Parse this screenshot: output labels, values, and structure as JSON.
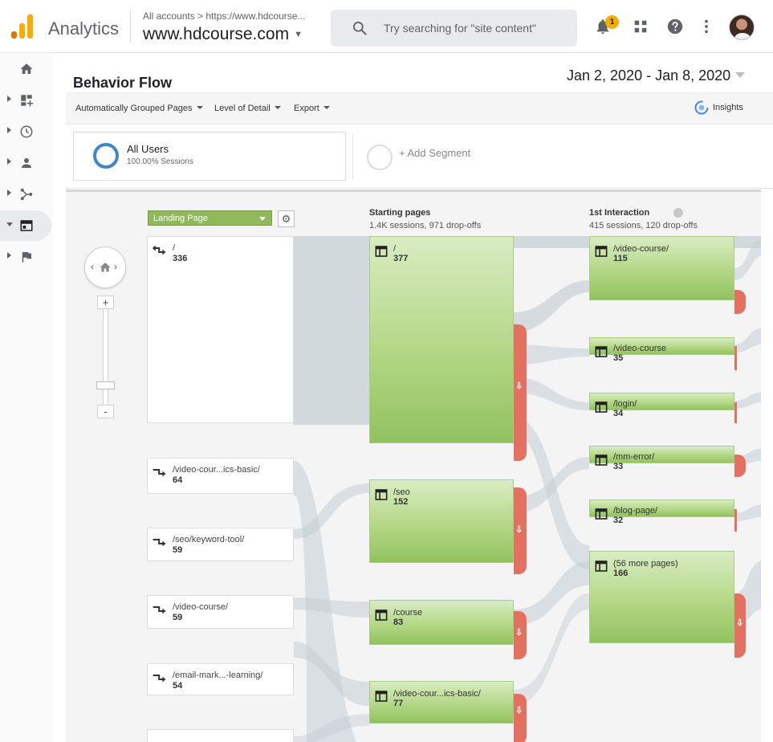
{
  "header": {
    "brand": "Analytics",
    "breadcrumb": "All accounts > https://www.hdcourse...",
    "property": "www.hdcourse.com",
    "search_placeholder": "Try searching for \"site content\"",
    "notification_count": "1"
  },
  "report": {
    "title": "Behavior Flow",
    "date_range": "Jan 2, 2020 - Jan 8, 2020",
    "toolbar": {
      "grouping": "Automatically Grouped Pages",
      "detail": "Level of Detail",
      "export": "Export",
      "insights": "Insights"
    },
    "segments": {
      "primary_name": "All Users",
      "primary_sub": "100.00% Sessions",
      "add_label": "+ Add Segment"
    }
  },
  "flow": {
    "dimension": "Landing Page",
    "columns": {
      "starting": {
        "title": "Starting pages",
        "sub": "1.4K sessions, 971 drop-offs"
      },
      "first": {
        "title": "1st Interaction",
        "sub": "415 sessions, 120 drop-offs"
      }
    },
    "landing_pages": [
      {
        "name": "/",
        "sessions": "336"
      },
      {
        "name": "/video-cour...ics-basic/",
        "sessions": "64"
      },
      {
        "name": "/seo/keyword-tool/",
        "sessions": "59"
      },
      {
        "name": "/video-course/",
        "sessions": "59"
      },
      {
        "name": "/email-mark...-learning/",
        "sessions": "54"
      }
    ],
    "starting_pages": [
      {
        "name": "/",
        "sessions": "377"
      },
      {
        "name": "/seo",
        "sessions": "152"
      },
      {
        "name": "/course",
        "sessions": "83"
      },
      {
        "name": "/video-cour...ics-basic/",
        "sessions": "77"
      }
    ],
    "first_interaction": [
      {
        "name": "/video-course/",
        "sessions": "115"
      },
      {
        "name": "/video-course",
        "sessions": "35"
      },
      {
        "name": "/login/",
        "sessions": "34"
      },
      {
        "name": "/mm-error/",
        "sessions": "33"
      },
      {
        "name": "/blog-page/",
        "sessions": "32"
      },
      {
        "name": "(56 more pages)",
        "sessions": "166"
      }
    ]
  },
  "colors": {
    "logo_orange": "#f9ab00",
    "logo_dark_orange": "#e37400",
    "node_green": "#a5cf74",
    "dropoff_red": "#e37060",
    "segment_blue": "#3d87c9",
    "connector_gray": "#c7d0d6"
  },
  "icons": [
    "analytics-logo-icon",
    "search-icon",
    "bell-icon",
    "apps-grid-icon",
    "help-icon",
    "more-vert-icon",
    "home-icon",
    "dashboard-icon",
    "clock-icon",
    "person-icon",
    "acquisition-icon",
    "behavior-icon",
    "flag-icon",
    "insights-icon",
    "gear-icon",
    "page-icon",
    "landing-arrow-icon",
    "dropoff-arrow-icon"
  ]
}
